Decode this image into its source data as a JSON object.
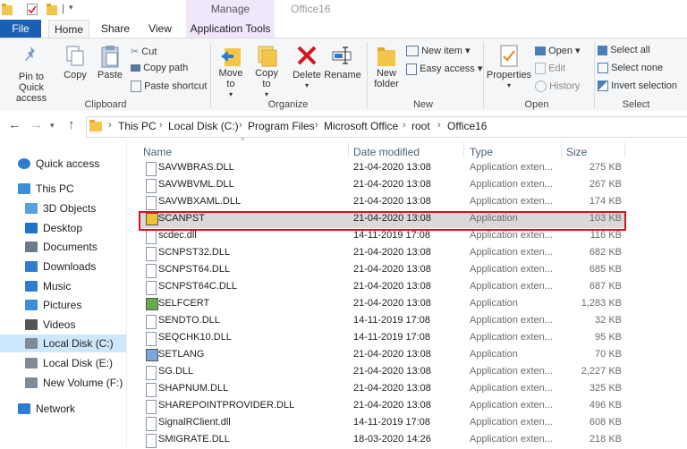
{
  "title_bar": {
    "manage_label": "Manage",
    "window_title": "Office16"
  },
  "tabs": {
    "file": "File",
    "home": "Home",
    "share": "Share",
    "view": "View",
    "app_tools": "Application Tools"
  },
  "ribbon": {
    "clipboard": {
      "label": "Clipboard",
      "pin": "Pin to Quick access",
      "copy": "Copy",
      "paste": "Paste",
      "cut": "Cut",
      "copy_path": "Copy path",
      "paste_shortcut": "Paste shortcut"
    },
    "organize": {
      "label": "Organize",
      "move_to": "Move to",
      "copy_to": "Copy to",
      "delete": "Delete",
      "rename": "Rename"
    },
    "new": {
      "label": "New",
      "new_folder": "New folder",
      "new_item": "New item",
      "easy_access": "Easy access"
    },
    "open": {
      "label": "Open",
      "properties": "Properties",
      "open": "Open",
      "edit": "Edit",
      "history": "History"
    },
    "select": {
      "label": "Select",
      "select_all": "Select all",
      "select_none": "Select none",
      "invert_selection": "Invert selection"
    }
  },
  "address": {
    "crumbs": [
      "This PC",
      "Local Disk (C:)",
      "Program Files",
      "Microsoft Office",
      "root",
      "Office16"
    ]
  },
  "sidebar": {
    "items": [
      {
        "label": "Quick access",
        "icon": "star-icon"
      },
      {
        "label": "This PC",
        "icon": "computer-icon"
      },
      {
        "label": "3D Objects",
        "icon": "cube-icon"
      },
      {
        "label": "Desktop",
        "icon": "desktop-icon"
      },
      {
        "label": "Documents",
        "icon": "document-icon"
      },
      {
        "label": "Downloads",
        "icon": "download-icon"
      },
      {
        "label": "Music",
        "icon": "music-icon"
      },
      {
        "label": "Pictures",
        "icon": "picture-icon"
      },
      {
        "label": "Videos",
        "icon": "video-icon"
      },
      {
        "label": "Local Disk (C:)",
        "icon": "drive-icon"
      },
      {
        "label": "Local Disk (E:)",
        "icon": "drive-icon"
      },
      {
        "label": "New Volume (F:)",
        "icon": "drive-icon"
      },
      {
        "label": "Network",
        "icon": "network-icon"
      }
    ]
  },
  "columns": {
    "name": "Name",
    "date": "Date modified",
    "type": "Type",
    "size": "Size"
  },
  "files": [
    {
      "name": "SAVWBRAS.DLL",
      "date": "21-04-2020 13:08",
      "type": "Application exten...",
      "size": "275 KB"
    },
    {
      "name": "SAVWBVML.DLL",
      "date": "21-04-2020 13:08",
      "type": "Application exten...",
      "size": "267 KB"
    },
    {
      "name": "SAVWBXAML.DLL",
      "date": "21-04-2020 13:08",
      "type": "Application exten...",
      "size": "174 KB"
    },
    {
      "name": "SCANPST",
      "date": "21-04-2020 13:08",
      "type": "Application",
      "size": "103 KB"
    },
    {
      "name": "scdec.dll",
      "date": "14-11-2019 17:08",
      "type": "Application exten...",
      "size": "116 KB"
    },
    {
      "name": "SCNPST32.DLL",
      "date": "21-04-2020 13:08",
      "type": "Application exten...",
      "size": "682 KB"
    },
    {
      "name": "SCNPST64.DLL",
      "date": "21-04-2020 13:08",
      "type": "Application exten...",
      "size": "685 KB"
    },
    {
      "name": "SCNPST64C.DLL",
      "date": "21-04-2020 13:08",
      "type": "Application exten...",
      "size": "687 KB"
    },
    {
      "name": "SELFCERT",
      "date": "21-04-2020 13:08",
      "type": "Application",
      "size": "1,283 KB"
    },
    {
      "name": "SENDTO.DLL",
      "date": "14-11-2019 17:08",
      "type": "Application exten...",
      "size": "32 KB"
    },
    {
      "name": "SEQCHK10.DLL",
      "date": "14-11-2019 17:08",
      "type": "Application exten...",
      "size": "95 KB"
    },
    {
      "name": "SETLANG",
      "date": "21-04-2020 13:08",
      "type": "Application",
      "size": "70 KB"
    },
    {
      "name": "SG.DLL",
      "date": "21-04-2020 13:08",
      "type": "Application exten...",
      "size": "2,227 KB"
    },
    {
      "name": "SHAPNUM.DLL",
      "date": "21-04-2020 13:08",
      "type": "Application exten...",
      "size": "325 KB"
    },
    {
      "name": "SHAREPOINTPROVIDER.DLL",
      "date": "21-04-2020 13:08",
      "type": "Application exten...",
      "size": "496 KB"
    },
    {
      "name": "SignalRClient.dll",
      "date": "14-11-2019 17:08",
      "type": "Application exten...",
      "size": "608 KB"
    },
    {
      "name": "SMIGRATE.DLL",
      "date": "18-03-2020 14:26",
      "type": "Application exten...",
      "size": "218 KB"
    }
  ],
  "colors": {
    "file_tab": "#1a5fb4",
    "manage_tab": "#f1e7fb",
    "highlight": "#d0161f",
    "selected_row": "#d9d9d9",
    "sidebar_selected": "#cce8ff"
  }
}
